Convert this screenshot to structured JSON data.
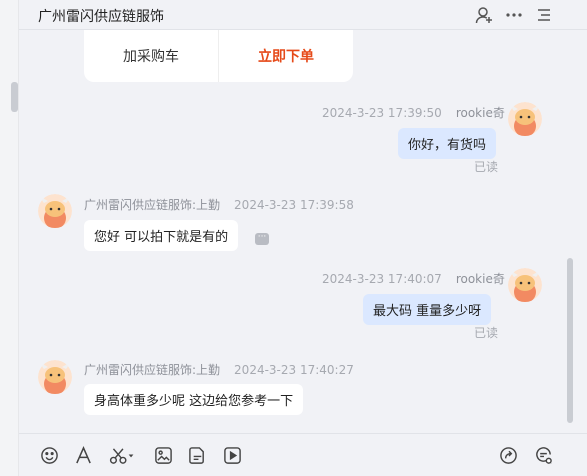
{
  "header": {
    "title": "广州雷闪供应链服饰",
    "icons": [
      "add-user-icon",
      "more-icon",
      "list-icon"
    ]
  },
  "order_card": {
    "cart_label": "加采购车",
    "buy_label": "立即下单",
    "buy_color": "#e64a19"
  },
  "messages": [
    {
      "direction": "out",
      "timestamp": "2024-3-23 17:39:50",
      "sender": "rookie奇",
      "text": "你好，有货吗",
      "status": "已读"
    },
    {
      "direction": "in",
      "sender": "广州雷闪供应链服饰:上勤",
      "timestamp": "2024-3-23 17:39:58",
      "text": "您好 可以拍下就是有的"
    },
    {
      "direction": "out",
      "timestamp": "2024-3-23 17:40:07",
      "sender": "rookie奇",
      "text": "最大码  重量多少呀",
      "status": "已读"
    },
    {
      "direction": "in",
      "sender": "广州雷闪供应链服饰:上勤",
      "timestamp": "2024-3-23 17:40:27",
      "text": "身高体重多少呢 这边给您参考一下"
    }
  ],
  "toolbar": {
    "left_icons": [
      "emoji-icon",
      "font-icon",
      "scissors-icon",
      "image-icon",
      "file-icon",
      "video-icon"
    ],
    "right_icons": [
      "share-icon",
      "quick-reply-icon"
    ]
  },
  "colors": {
    "outgoing_bubble": "#dbe8ff",
    "incoming_bubble": "#ffffff",
    "panel_bg": "#f1f2f6"
  }
}
